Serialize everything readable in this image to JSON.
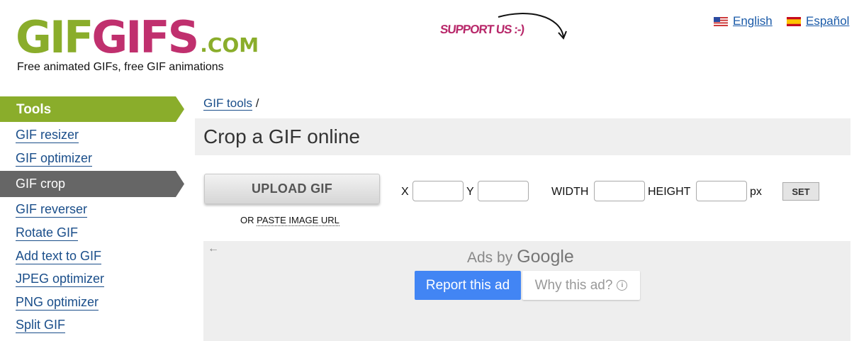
{
  "header": {
    "logo": {
      "part1": "GIF",
      "part2": "GIFS",
      "part3": ".COM"
    },
    "tagline": "Free animated GIFs, free GIF animations",
    "support_label": "SUPPORT US :-)",
    "languages": [
      {
        "label": "English",
        "icon": "us-flag-icon"
      },
      {
        "label": "Español",
        "icon": "spain-flag-icon"
      }
    ]
  },
  "sidebar": {
    "heading": "Tools",
    "items": [
      {
        "label": "GIF resizer"
      },
      {
        "label": "GIF optimizer"
      },
      {
        "label": "GIF crop",
        "active": true
      },
      {
        "label": "GIF reverser"
      },
      {
        "label": "Rotate GIF"
      },
      {
        "label": "Add text to GIF"
      },
      {
        "label": "JPEG optimizer"
      },
      {
        "label": "PNG optimizer"
      },
      {
        "label": "Split GIF"
      }
    ]
  },
  "main": {
    "breadcrumb": {
      "link": "GIF tools",
      "separator": "/"
    },
    "title": "Crop a GIF online",
    "upload_label": "UPLOAD GIF",
    "paste_prefix": "OR",
    "paste_link": "PASTE IMAGE URL",
    "fields": {
      "x_label": "X",
      "x_value": "",
      "y_label": "Y",
      "y_value": "",
      "width_label": "WIDTH",
      "width_value": "",
      "height_label": "HEIGHT",
      "height_value": "",
      "unit": "px"
    },
    "set_label": "SET"
  },
  "ad": {
    "ads_by": "Ads by",
    "google": "Google",
    "report_label": "Report this ad",
    "why_label": "Why this ad?",
    "back_icon": "back-arrow-icon"
  },
  "colors": {
    "brand_green": "#8aad2b",
    "brand_pink": "#c0306e",
    "sidebar_active": "#666666",
    "link": "#1a4e8a",
    "ad_button": "#4285f4"
  }
}
